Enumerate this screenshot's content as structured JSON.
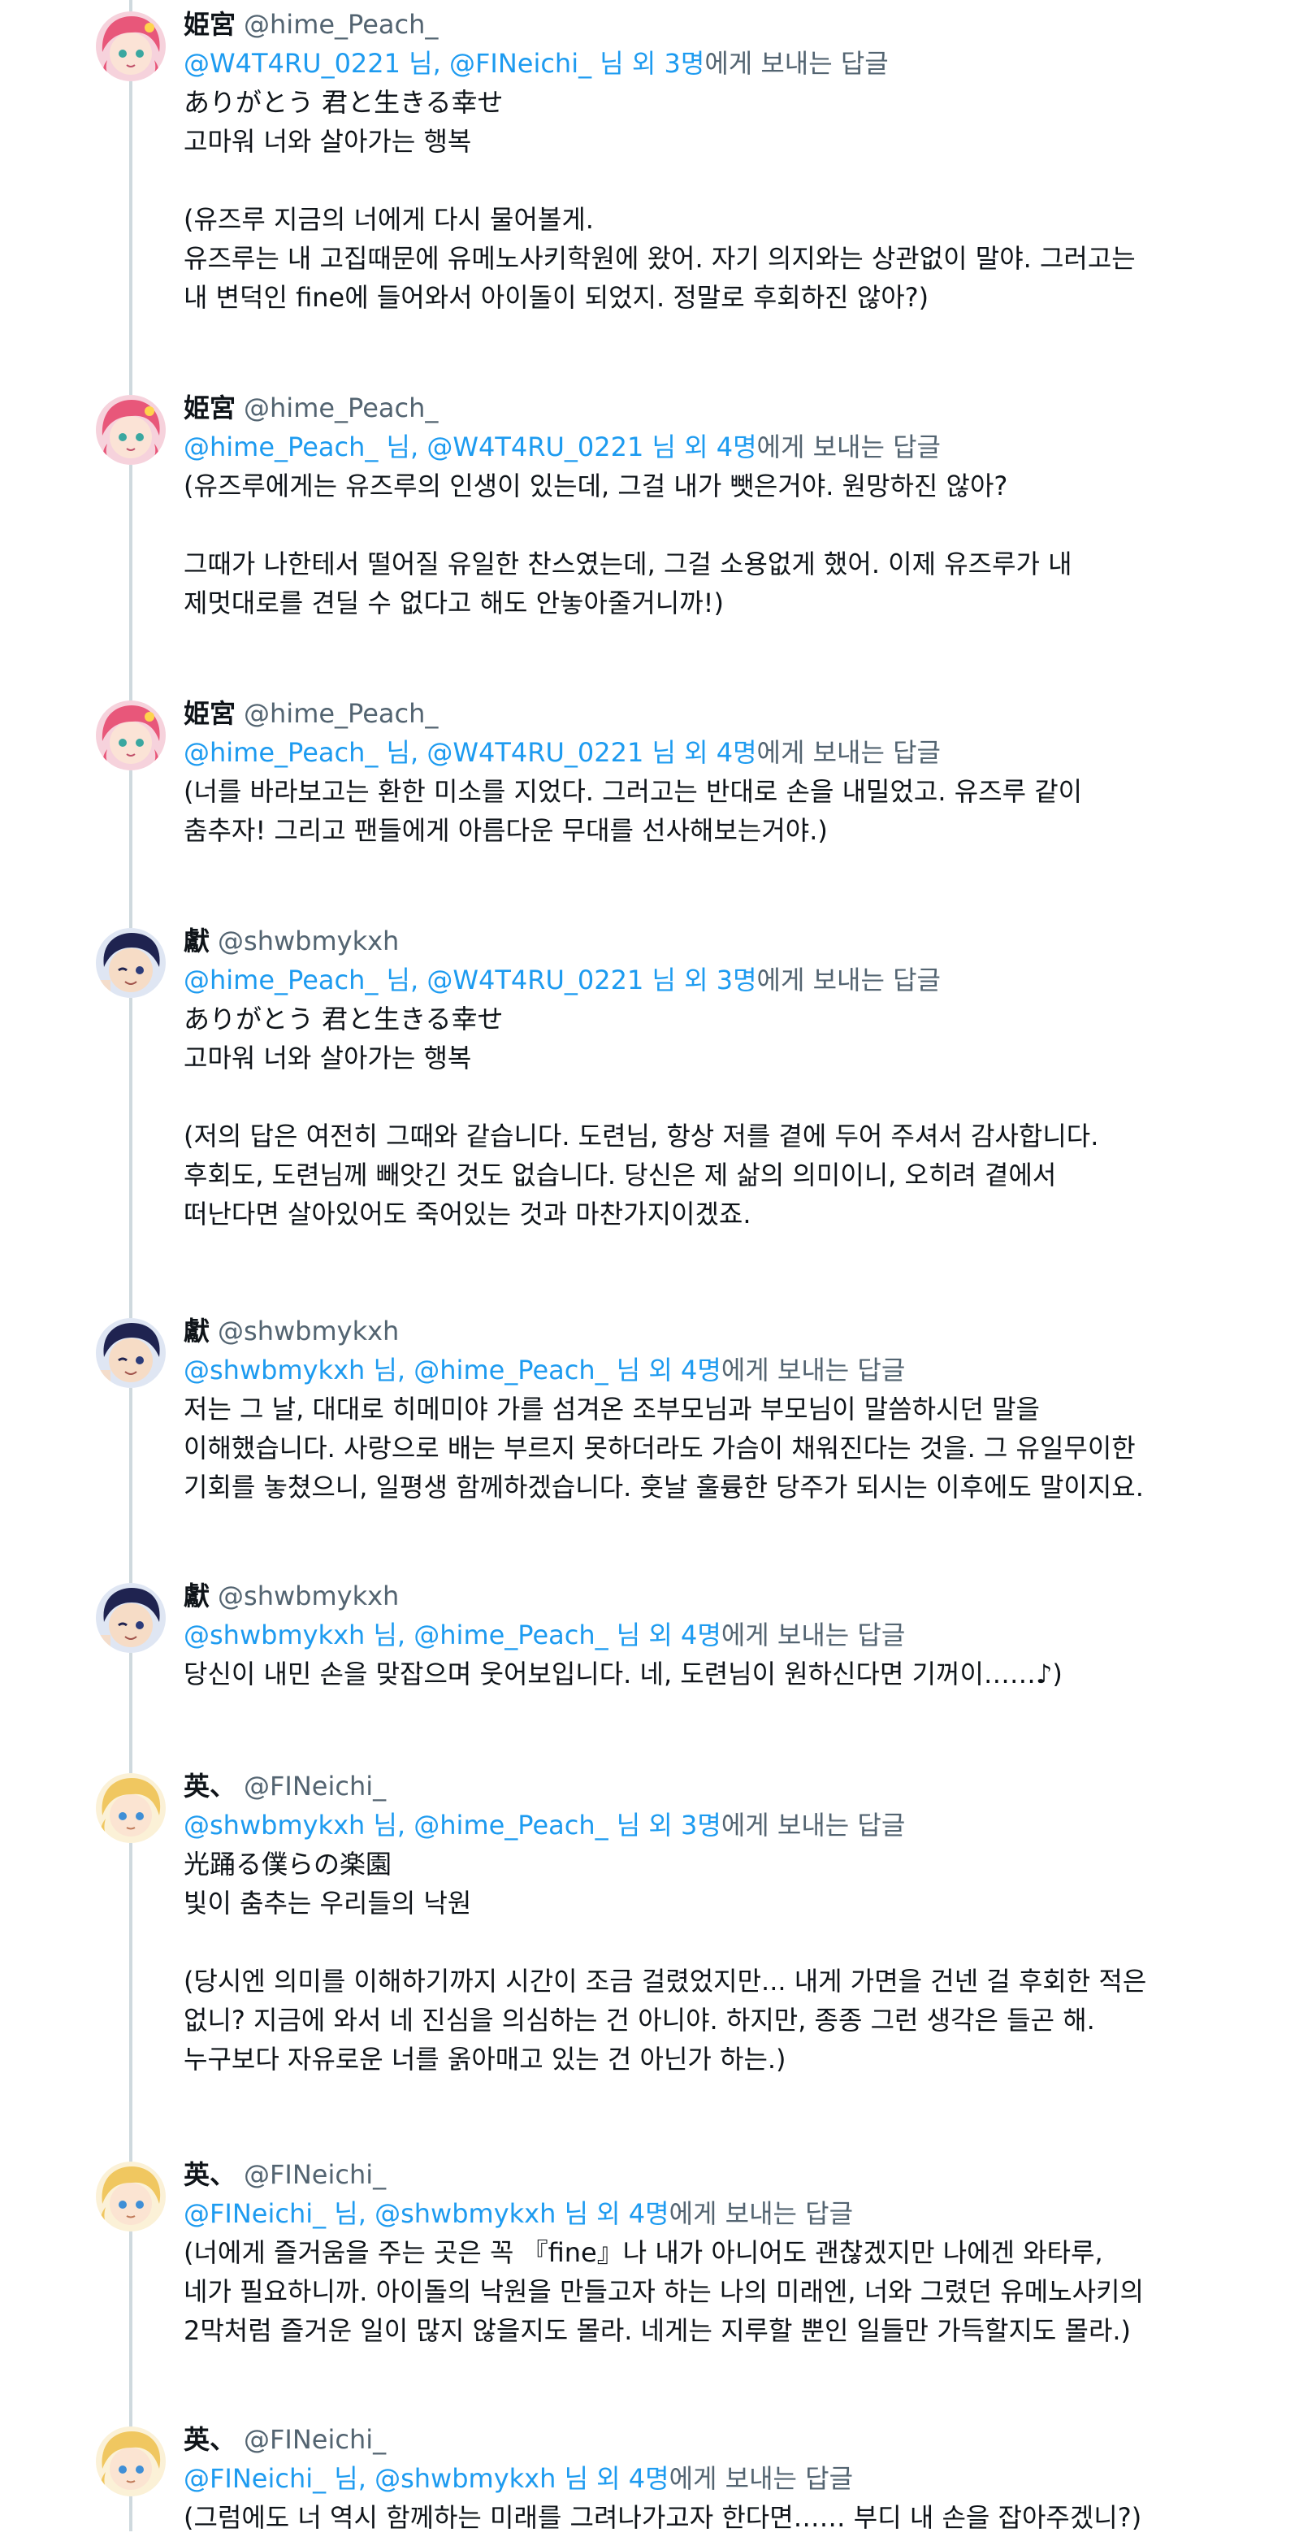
{
  "tweets": [
    {
      "avatar_icon": "pink-hair-avatar-icon",
      "display_name": "姫宮",
      "handle": "@hime_Peach_",
      "reply_to": {
        "user1": "@W4T4RU_0221",
        "sep1": " 님, ",
        "user2": "@FINeichi_",
        "sep2": " 님 외 ",
        "others": "3명",
        "suffix": "에게 보내는 답글"
      },
      "lines": [
        "ありがとう 君と生きる幸せ",
        "고마워 너와 살아가는 행복",
        "",
        "(유즈루 지금의 너에게 다시 물어볼게.",
        "유즈루는 내 고집때문에 유메노사키학원에 왔어. 자기 의지와는 상관없이 말야. 그러고는",
        "내 변덕인 fine에 들어와서 아이돌이 되었지. 정말로 후회하진 않아?)"
      ]
    },
    {
      "avatar_icon": "pink-hair-avatar-icon",
      "display_name": "姫宮",
      "handle": "@hime_Peach_",
      "reply_to": {
        "user1": "@hime_Peach_",
        "sep1": " 님, ",
        "user2": "@W4T4RU_0221",
        "sep2": " 님 외 ",
        "others": "4명",
        "suffix": "에게 보내는 답글"
      },
      "lines": [
        "(유즈루에게는 유즈루의 인생이 있는데, 그걸 내가 뺏은거야. 원망하진 않아?",
        "",
        "그때가 나한테서 떨어질 유일한 찬스였는데, 그걸 소용없게 했어. 이제 유즈루가 내",
        "제멋대로를 견딜 수 없다고 해도 안놓아줄거니까!)"
      ]
    },
    {
      "avatar_icon": "pink-hair-avatar-icon",
      "display_name": "姫宮",
      "handle": "@hime_Peach_",
      "reply_to": {
        "user1": "@hime_Peach_",
        "sep1": " 님, ",
        "user2": "@W4T4RU_0221",
        "sep2": " 님 외 ",
        "others": "4명",
        "suffix": "에게 보내는 답글"
      },
      "lines": [
        "(너를 바라보고는 환한 미소를 지었다. 그러고는 반대로 손을 내밀었고. 유즈루 같이",
        "춤추자! 그리고 팬들에게 아름다운 무대를 선사해보는거야.)"
      ]
    },
    {
      "avatar_icon": "dark-hair-avatar-icon",
      "display_name": "獻",
      "handle": "@shwbmykxh",
      "reply_to": {
        "user1": "@hime_Peach_",
        "sep1": " 님, ",
        "user2": "@W4T4RU_0221",
        "sep2": " 님 외 ",
        "others": "3명",
        "suffix": "에게 보내는 답글"
      },
      "lines": [
        "ありがとう 君と生きる幸せ",
        "고마워 너와 살아가는 행복",
        "",
        "(저의 답은 여전히 그때와 같습니다. 도련님, 항상 저를 곁에 두어 주셔서 감사합니다.",
        "후회도, 도련님께 빼앗긴 것도 없습니다. 당신은 제 삶의 의미이니, 오히려 곁에서",
        "떠난다면 살아있어도 죽어있는 것과 마찬가지이겠죠."
      ]
    },
    {
      "avatar_icon": "dark-hair-avatar-icon",
      "display_name": "獻",
      "handle": "@shwbmykxh",
      "reply_to": {
        "user1": "@shwbmykxh",
        "sep1": " 님, ",
        "user2": "@hime_Peach_",
        "sep2": " 님 외 ",
        "others": "4명",
        "suffix": "에게 보내는 답글"
      },
      "lines": [
        "저는 그 날, 대대로 히메미야 가를 섬겨온 조부모님과 부모님이 말씀하시던 말을",
        "이해했습니다. 사랑으로 배는 부르지 못하더라도 가슴이 채워진다는 것을. 그 유일무이한",
        "기회를 놓쳤으니, 일평생 함께하겠습니다. 훗날 훌륭한 당주가 되시는 이후에도 말이지요."
      ]
    },
    {
      "avatar_icon": "dark-hair-avatar-icon",
      "display_name": "獻",
      "handle": "@shwbmykxh",
      "reply_to": {
        "user1": "@shwbmykxh",
        "sep1": " 님, ",
        "user2": "@hime_Peach_",
        "sep2": " 님 외 ",
        "others": "4명",
        "suffix": "에게 보내는 답글"
      },
      "lines": [
        "당신이 내민 손을 맞잡으며 웃어보입니다. 네, 도련님이 원하신다면 기꺼이……♪)"
      ]
    },
    {
      "avatar_icon": "blond-hair-avatar-icon",
      "display_name": "英、",
      "handle": "@FINeichi_",
      "reply_to": {
        "user1": "@shwbmykxh",
        "sep1": " 님, ",
        "user2": "@hime_Peach_",
        "sep2": " 님 외 ",
        "others": "3명",
        "suffix": "에게 보내는 답글"
      },
      "lines": [
        "光踊る僕らの楽園",
        "빛이 춤추는 우리들의 낙원",
        "",
        "(당시엔 의미를 이해하기까지 시간이 조금 걸렸었지만... 내게 가면을 건넨 걸 후회한 적은",
        "없니? 지금에 와서 네 진심을 의심하는 건 아니야. 하지만, 종종 그런 생각은 들곤 해.",
        "누구보다 자유로운 너를 옭아매고 있는 건 아닌가 하는.)"
      ]
    },
    {
      "avatar_icon": "blond-hair-avatar-icon",
      "display_name": "英、",
      "handle": "@FINeichi_",
      "reply_to": {
        "user1": "@FINeichi_",
        "sep1": " 님, ",
        "user2": "@shwbmykxh",
        "sep2": " 님 외 ",
        "others": "4명",
        "suffix": "에게 보내는 답글"
      },
      "lines": [
        "(너에게 즐거움을 주는 곳은 꼭 『fine』나 내가 아니어도 괜찮겠지만 나에겐 와타루,",
        "네가 필요하니까. 아이돌의 낙원을 만들고자 하는 나의 미래엔, 너와 그렸던 유메노사키의",
        "2막처럼 즐거운 일이 많지 않을지도 몰라. 네게는 지루할 뿐인 일들만 가득할지도 몰라.)"
      ]
    },
    {
      "avatar_icon": "blond-hair-avatar-icon",
      "display_name": "英、",
      "handle": "@FINeichi_",
      "reply_to": {
        "user1": "@FINeichi_",
        "sep1": " 님, ",
        "user2": "@shwbmykxh",
        "sep2": " 님 외 ",
        "others": "4명",
        "suffix": "에게 보내는 답글"
      },
      "lines": [
        "(그럼에도 너 역시 함께하는 미래를 그려나가고자 한다면…… 부디 내 손을 잡아주겠니?)"
      ]
    }
  ]
}
